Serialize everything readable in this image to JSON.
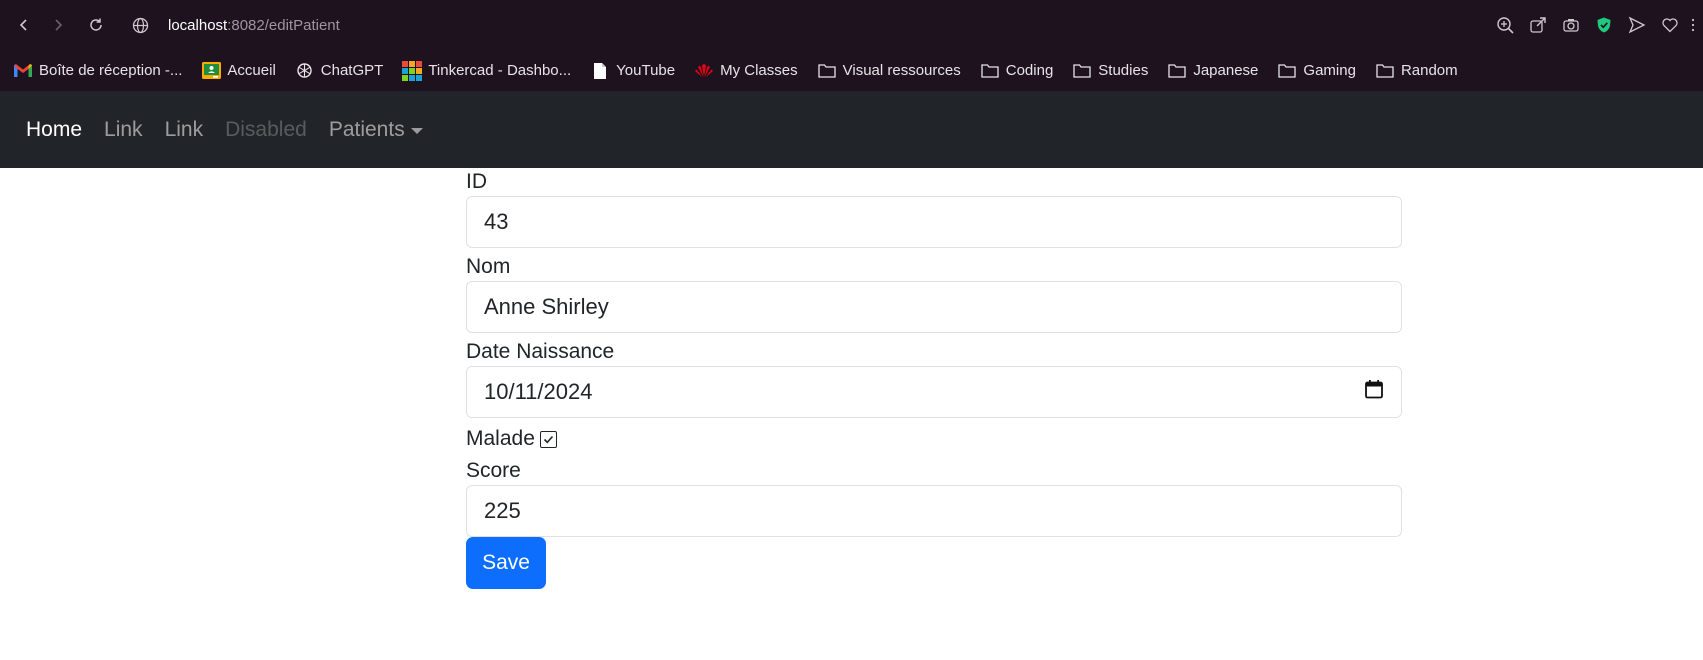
{
  "browser": {
    "url_host": "localhost",
    "url_path": ":8082/editPatient",
    "bookmarks": [
      {
        "label": "Boîte de réception -...",
        "icon": "gmail-icon"
      },
      {
        "label": "Accueil",
        "icon": "classroom-icon"
      },
      {
        "label": "ChatGPT",
        "icon": "chatgpt-icon"
      },
      {
        "label": "Tinkercad - Dashbo...",
        "icon": "tinkercad-icon"
      },
      {
        "label": "YouTube",
        "icon": "page-icon"
      },
      {
        "label": "My Classes",
        "icon": "huawei-icon"
      },
      {
        "label": "Visual ressources",
        "icon": "folder-icon"
      },
      {
        "label": "Coding",
        "icon": "folder-icon"
      },
      {
        "label": "Studies",
        "icon": "folder-icon"
      },
      {
        "label": "Japanese",
        "icon": "folder-icon"
      },
      {
        "label": "Gaming",
        "icon": "folder-icon"
      },
      {
        "label": "Random",
        "icon": "folder-icon"
      }
    ]
  },
  "navbar": {
    "items": [
      {
        "label": "Home",
        "state": "active"
      },
      {
        "label": "Link",
        "state": "normal"
      },
      {
        "label": "Link",
        "state": "normal"
      },
      {
        "label": "Disabled",
        "state": "disabled"
      },
      {
        "label": "Patients",
        "state": "dropdown"
      }
    ]
  },
  "form": {
    "id_label": "ID",
    "id_value": "43",
    "nom_label": "Nom",
    "nom_value": "Anne Shirley",
    "date_label": "Date Naissance",
    "date_value": "10/11/2024",
    "malade_label": "Malade",
    "malade_checked": true,
    "score_label": "Score",
    "score_value": "225",
    "save_label": "Save"
  },
  "colors": {
    "chrome_bg": "#1d121d",
    "navbar_bg": "#212529",
    "primary": "#0d6efd"
  }
}
